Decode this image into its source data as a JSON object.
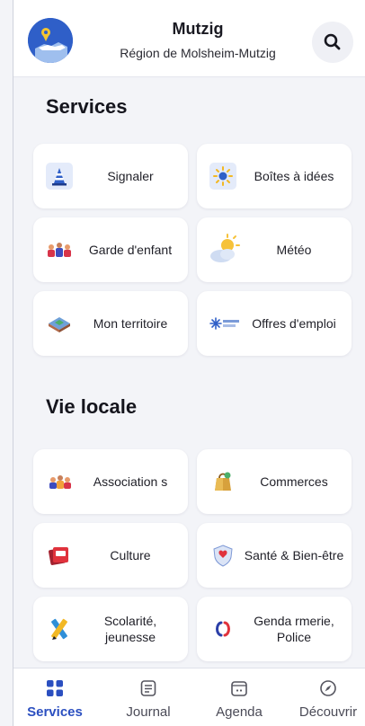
{
  "header": {
    "town": "Mutzig",
    "region": "Région de Molsheim-Mutzig",
    "search_icon": "search-icon"
  },
  "services": {
    "title": "Services",
    "items": [
      {
        "label": "Signaler",
        "icon": "cone-icon"
      },
      {
        "label": "Boîtes à idées",
        "icon": "lightbulb-icon"
      },
      {
        "label": "Garde d'enfant",
        "icon": "children-icon"
      },
      {
        "label": "Météo",
        "icon": "weather-icon"
      },
      {
        "label": "Mon territoire",
        "icon": "territory-icon"
      },
      {
        "label": "Offres d'emploi",
        "icon": "jobs-logo-icon"
      }
    ]
  },
  "vie_locale": {
    "title": "Vie locale",
    "items": [
      {
        "label": "Association s",
        "icon": "people-icon"
      },
      {
        "label": "Commerces",
        "icon": "shopping-bag-icon"
      },
      {
        "label": "Culture",
        "icon": "culture-icon"
      },
      {
        "label": "Santé & Bien-être",
        "icon": "health-shield-icon"
      },
      {
        "label": "Scolarité, jeunesse",
        "icon": "pencil-icon"
      },
      {
        "label": "Genda rmerie, Police",
        "icon": "police-icon"
      }
    ]
  },
  "bottom_nav": {
    "items": [
      {
        "label": "Services",
        "icon": "grid-icon",
        "active": true
      },
      {
        "label": "Journal",
        "icon": "journal-icon",
        "active": false
      },
      {
        "label": "Agenda",
        "icon": "calendar-icon",
        "active": false
      },
      {
        "label": "Découvrir",
        "icon": "compass-icon",
        "active": false
      }
    ]
  },
  "colors": {
    "accent": "#2b4fc0",
    "background": "#f3f4f8",
    "card": "#ffffff"
  }
}
